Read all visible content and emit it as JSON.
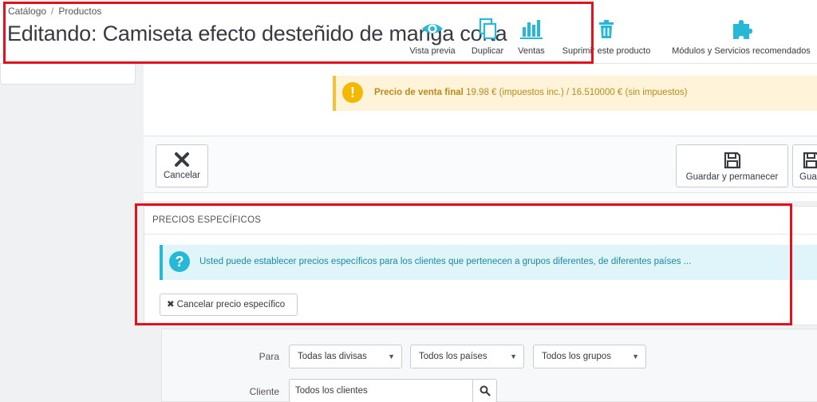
{
  "breadcrumb": {
    "item1": "Catálogo",
    "separator": "/",
    "item2": "Productos"
  },
  "page_title": "Editando: Camiseta efecto desteñido de manga corta",
  "toolbar": {
    "preview": "Vista previa",
    "duplicate": "Duplicar",
    "sales": "Ventas",
    "delete": "Suprimir este producto",
    "modules": "Módulos y Servicios recomendados"
  },
  "price_alert": {
    "label": "Precio de venta final",
    "value": "19.98 € (impuestos inc.) / 16.510000 € (sin impuestos)",
    "icon": "!"
  },
  "footer_buttons": {
    "cancel": "Cancelar",
    "save_stay": "Guardar y permanecer",
    "save_partial": "Gua"
  },
  "specific_prices": {
    "heading": "PRECIOS ESPECÍFICOS",
    "info_icon": "?",
    "info": "Usted puede establecer precios específicos para los clientes que pertenecen a grupos diferentes, de diferentes países ...",
    "cancel_button_icon": "✖",
    "cancel_button": "Cancelar precio específico"
  },
  "form": {
    "for_label": "Para",
    "currency": "Todas las divisas",
    "country": "Todos los países",
    "group": "Todos los grupos",
    "caret": "▼",
    "customer_label": "Cliente",
    "customer_value": "Todos los clientes"
  },
  "colors": {
    "accent": "#25b9d7",
    "warning": "#f6c235",
    "highlight_box": "#e3111b",
    "header_bg": "#ffffff",
    "page_bg": "#eff1f2"
  }
}
